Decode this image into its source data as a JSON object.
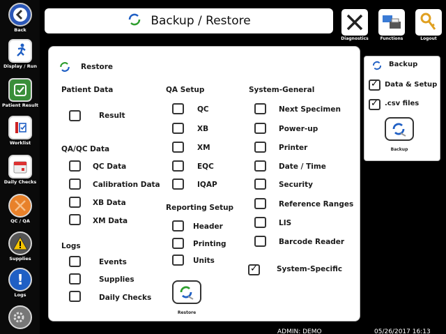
{
  "header": {
    "title": "Backup / Restore"
  },
  "sidebar": {
    "items": [
      {
        "label": "Back"
      },
      {
        "label": "Display / Run"
      },
      {
        "label": "Patient Results"
      },
      {
        "label": "Worklist"
      },
      {
        "label": "Daily Checks"
      },
      {
        "label": "QC / QA"
      },
      {
        "label": "Supplies"
      },
      {
        "label": "Logs"
      },
      {
        "label": ""
      }
    ]
  },
  "topbar": {
    "diagnostics": "Diagnostics",
    "functions": "Functions",
    "logout": "Logout"
  },
  "restore": {
    "title": "Restore",
    "button_label": "Restore",
    "patient": {
      "heading": "Patient Data",
      "items": [
        {
          "label": "Result",
          "checked": false
        }
      ]
    },
    "qaqc": {
      "heading": "QA/QC Data",
      "items": [
        {
          "label": "QC Data",
          "checked": false
        },
        {
          "label": "Calibration Data",
          "checked": false
        },
        {
          "label": "XB Data",
          "checked": false
        },
        {
          "label": "XM Data",
          "checked": false
        }
      ]
    },
    "logs": {
      "heading": "Logs",
      "items": [
        {
          "label": "Events",
          "checked": false
        },
        {
          "label": "Supplies",
          "checked": false
        },
        {
          "label": "Daily Checks",
          "checked": false
        }
      ]
    },
    "qa_setup": {
      "heading": "QA Setup",
      "items": [
        {
          "label": "QC",
          "checked": false
        },
        {
          "label": "XB",
          "checked": false
        },
        {
          "label": "XM",
          "checked": false
        },
        {
          "label": "EQC",
          "checked": false
        },
        {
          "label": "IQAP",
          "checked": false
        }
      ]
    },
    "reporting": {
      "heading": "Reporting Setup",
      "items": [
        {
          "label": "Header",
          "checked": false
        },
        {
          "label": "Printing",
          "checked": false
        },
        {
          "label": "Units",
          "checked": false
        }
      ]
    },
    "system_general": {
      "heading": "System-General",
      "items": [
        {
          "label": "Next Specimen",
          "checked": false
        },
        {
          "label": "Power-up",
          "checked": false
        },
        {
          "label": "Printer",
          "checked": false
        },
        {
          "label": "Date / Time",
          "checked": false
        },
        {
          "label": "Security",
          "checked": false
        },
        {
          "label": "Reference Ranges",
          "checked": false
        },
        {
          "label": "LIS",
          "checked": false
        },
        {
          "label": "Barcode Reader",
          "checked": false
        }
      ]
    },
    "system_specific": {
      "label": "System-Specific",
      "checked": true
    }
  },
  "backup": {
    "title": "Backup",
    "data_setup": {
      "label": "Data & Setup",
      "checked": true
    },
    "csv_files": {
      "label": ".csv files",
      "checked": true
    },
    "button_label": "Backup"
  },
  "status": {
    "user": "ADMIN: DEMO",
    "datetime": "05/26/2017 16:13"
  },
  "colors": {
    "accent_blue": "#1f5fc4",
    "restore_green": "#2e9e2e",
    "qc_orange": "#e8812a",
    "warning_yellow": "#f5c400"
  }
}
